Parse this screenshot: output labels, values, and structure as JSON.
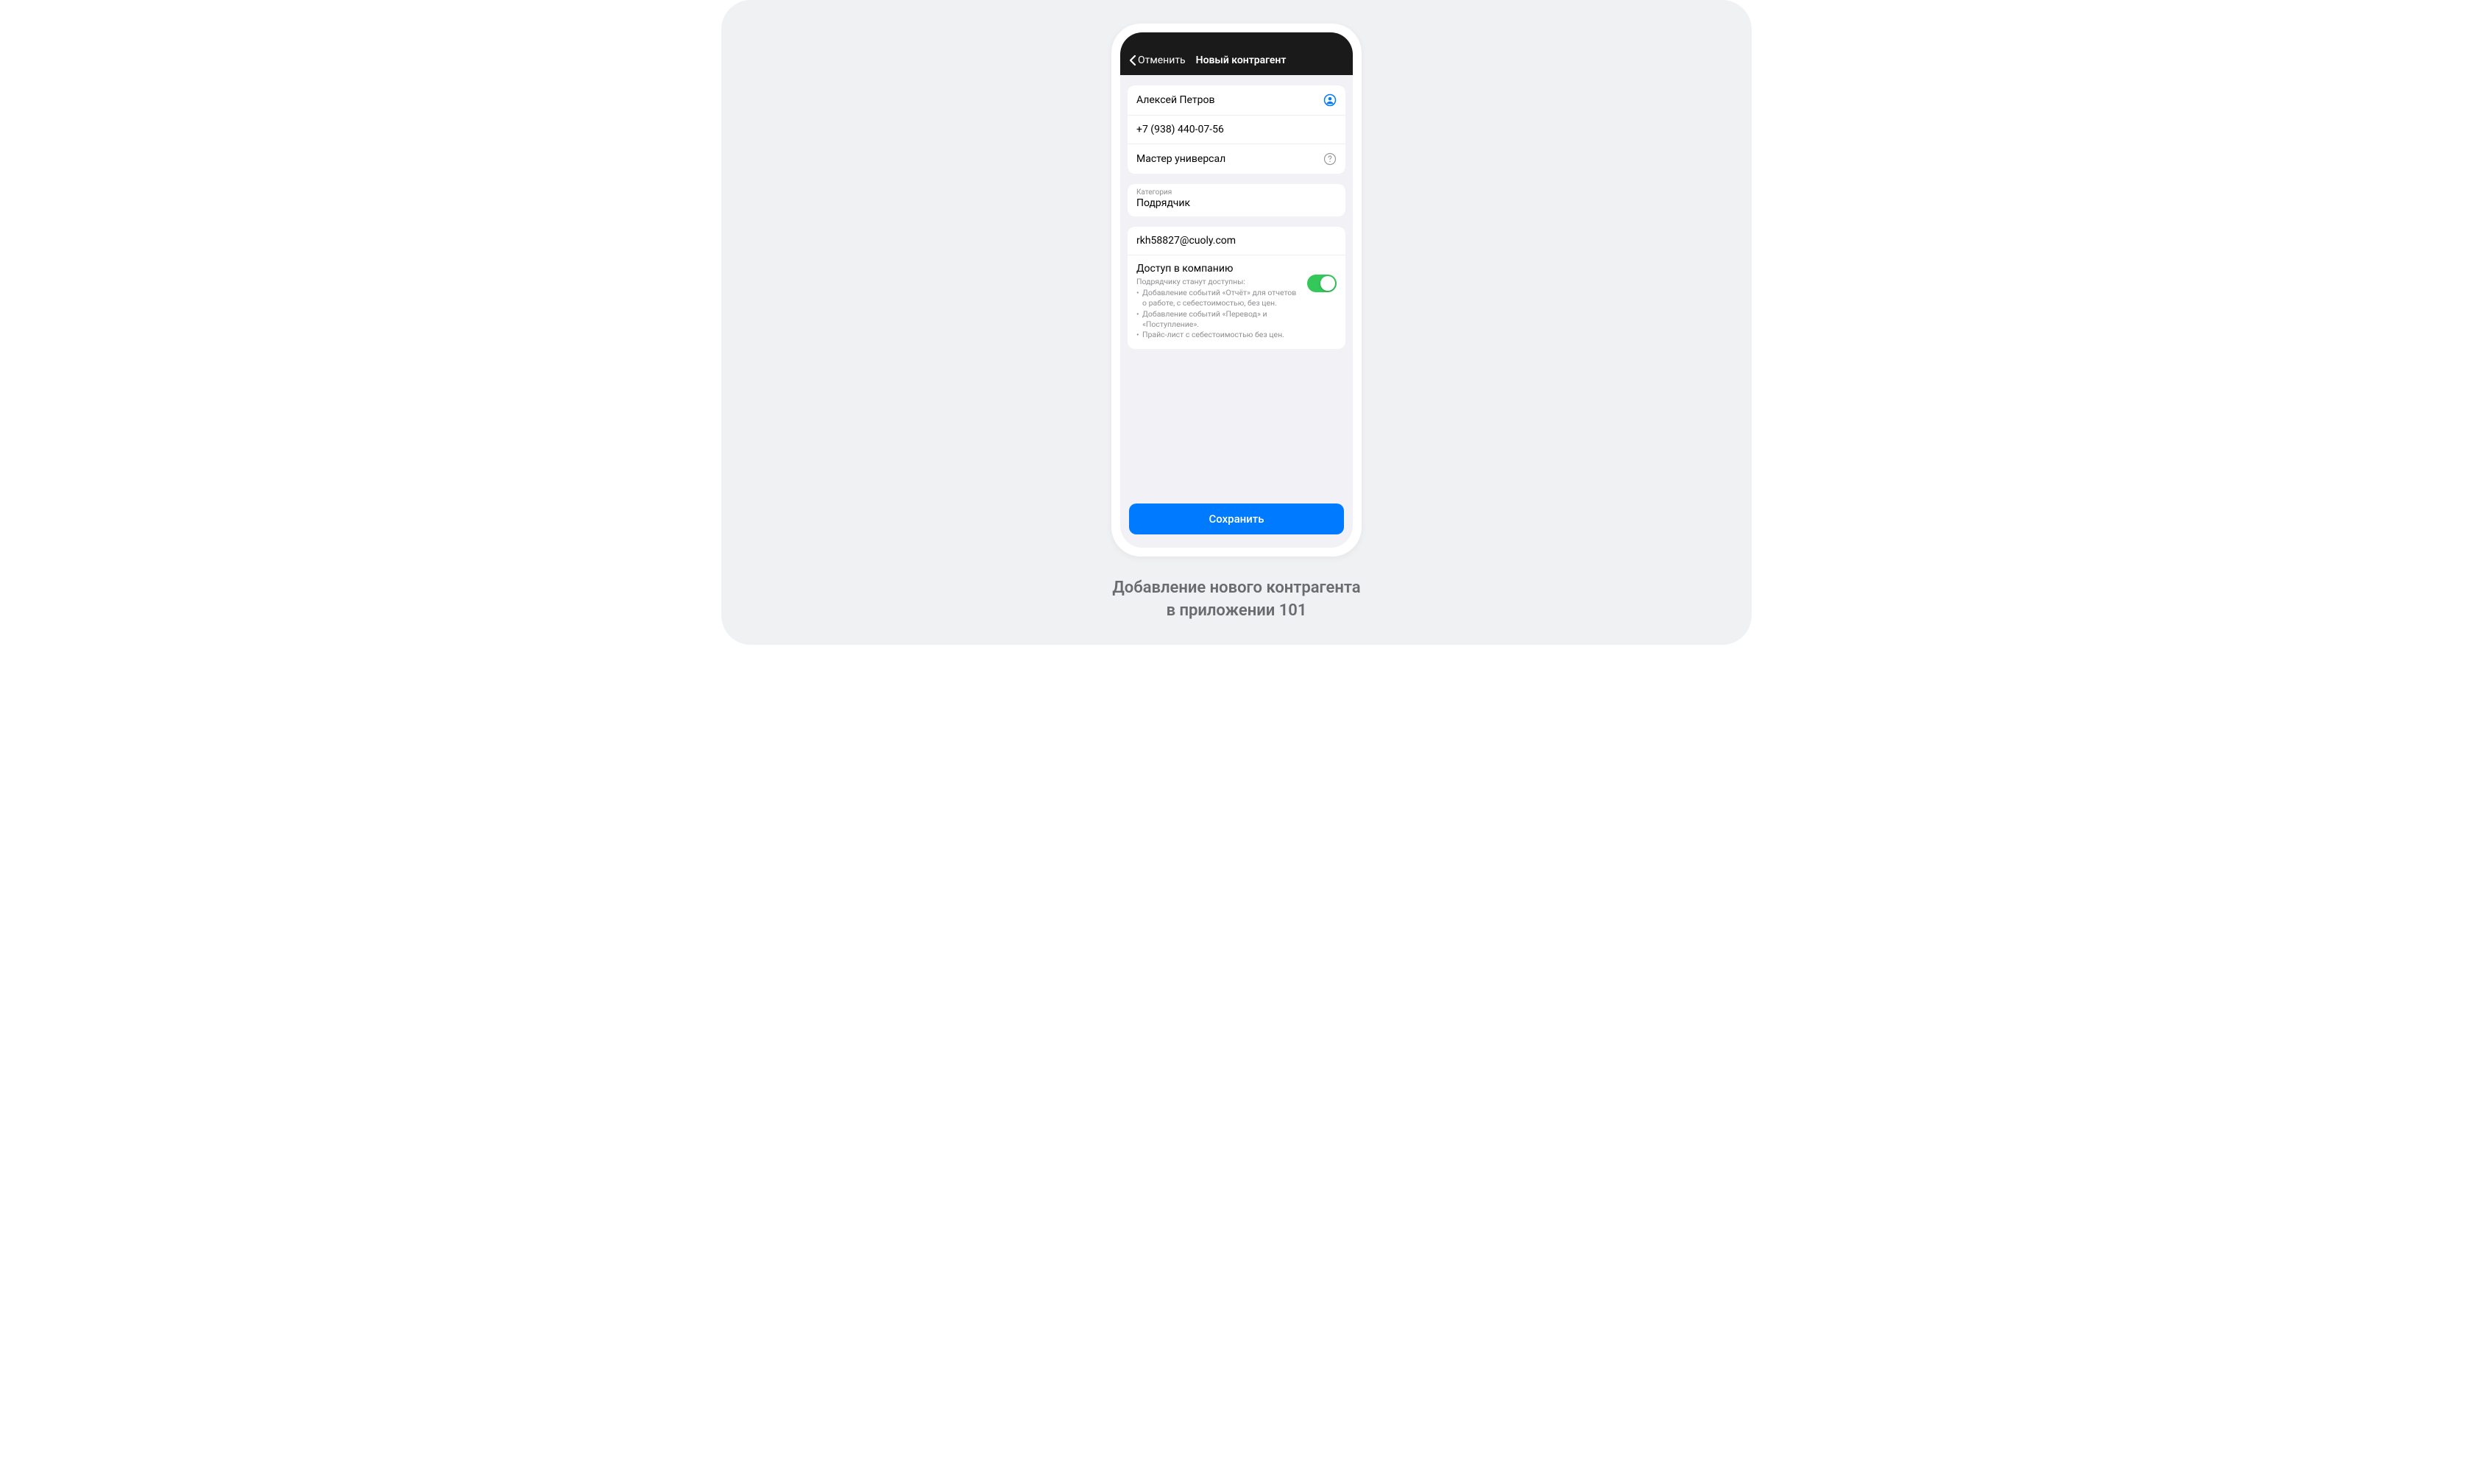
{
  "navbar": {
    "back_label": "Отменить",
    "title": "Новый контрагент"
  },
  "contact": {
    "name": "Алексей Петров",
    "phone": "+7 (938) 440-07-56",
    "role": "Мастер универсал"
  },
  "category": {
    "label": "Категория",
    "value": "Подрядчик"
  },
  "email": "rkh58827@cuoly.com",
  "access": {
    "title": "Доступ в компанию",
    "subtitle": "Подрядчику станут доступны:",
    "items": [
      "Добавление событий «Отчёт» для отчетов о работе, с себестоимостью, без цен.",
      "Добавление событий «Перевод» и «Поступление».",
      "Прайс-лист с себестоимостью без цен."
    ],
    "enabled": true
  },
  "save_label": "Сохранить",
  "caption": {
    "line1": "Добавление нового контрагента",
    "line2": "в приложении 101"
  }
}
